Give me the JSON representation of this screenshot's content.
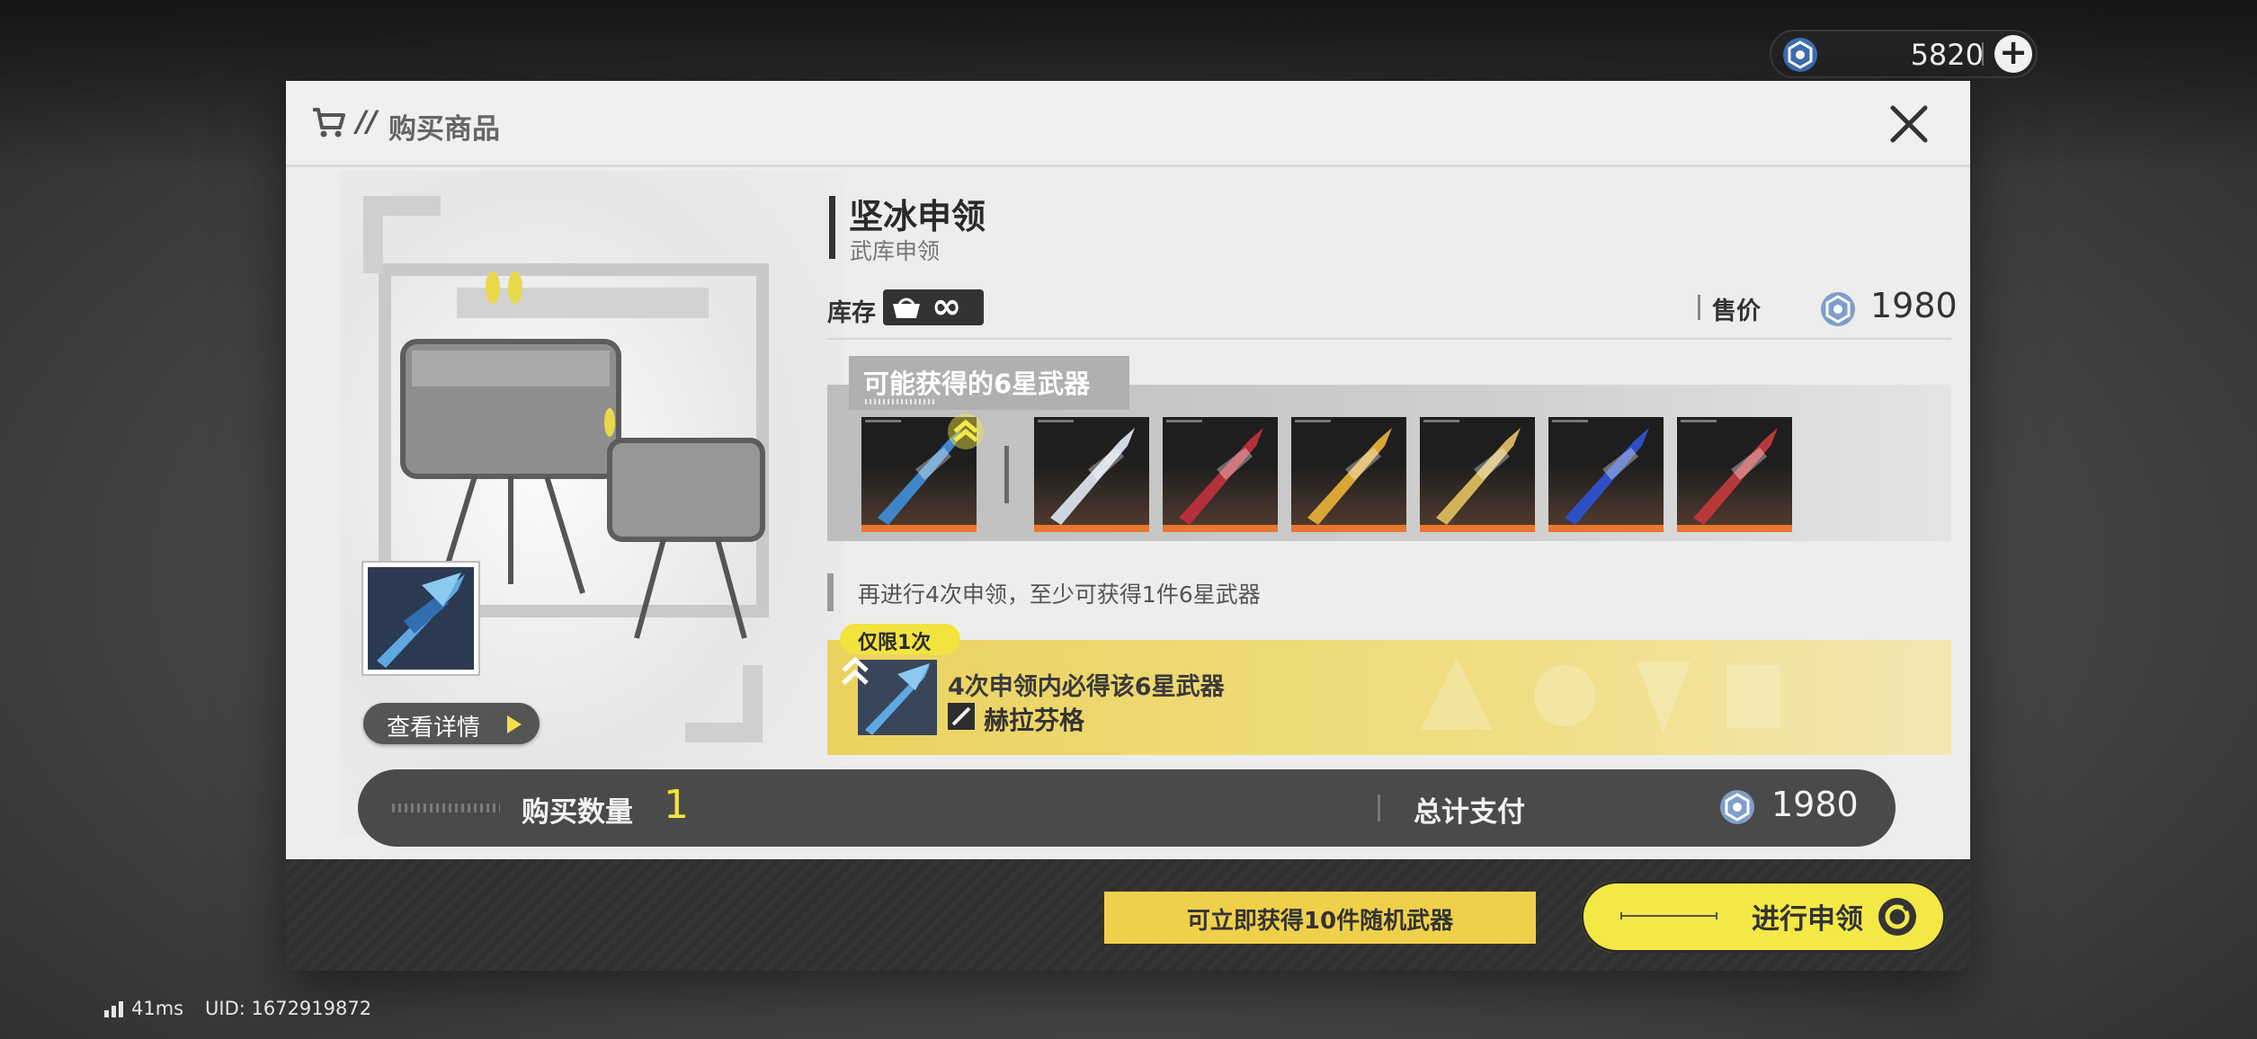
{
  "header": {
    "currency": {
      "amount": "5820",
      "add_label": "+"
    },
    "title": "购买商品",
    "slashes": "//"
  },
  "item": {
    "name": "坚冰申领",
    "subtitle": "武库申领",
    "stock_label": "库存",
    "stock_value": "∞",
    "price_label": "售价",
    "price_value": "1980"
  },
  "weapons": {
    "tab_label": "可能获得的6星武器",
    "cards": [
      {
        "name": "featured-weapon",
        "color": "#3f86c8"
      },
      {
        "name": "white-greatsword",
        "color": "#cfd6e0"
      },
      {
        "name": "red-blade",
        "color": "#b4303a"
      },
      {
        "name": "gold-orb",
        "color": "#d9a636"
      },
      {
        "name": "gold-lance",
        "color": "#d2b35a"
      },
      {
        "name": "blue-lance",
        "color": "#2e4fc4"
      },
      {
        "name": "red-gauntlet",
        "color": "#b8383a"
      }
    ]
  },
  "hint": "再进行4次申领，至少可获得1件6星武器",
  "guarantee": {
    "tag": "仅限1次",
    "line1": "4次申领内必得该6星武器",
    "weapon_name": "赫拉芬格"
  },
  "details_button": "查看详情",
  "purchase": {
    "quantity_label": "购买数量",
    "quantity_value": "1",
    "total_label": "总计支付",
    "total_value": "1980"
  },
  "footer": {
    "random_note": "可立即获得10件随机武器",
    "draw_button": "进行申领"
  },
  "status": {
    "ping": "41ms",
    "uid": "UID: 1672919872"
  },
  "colors": {
    "accent_yellow": "#f4e846",
    "rarity_orange": "#e8772f"
  }
}
